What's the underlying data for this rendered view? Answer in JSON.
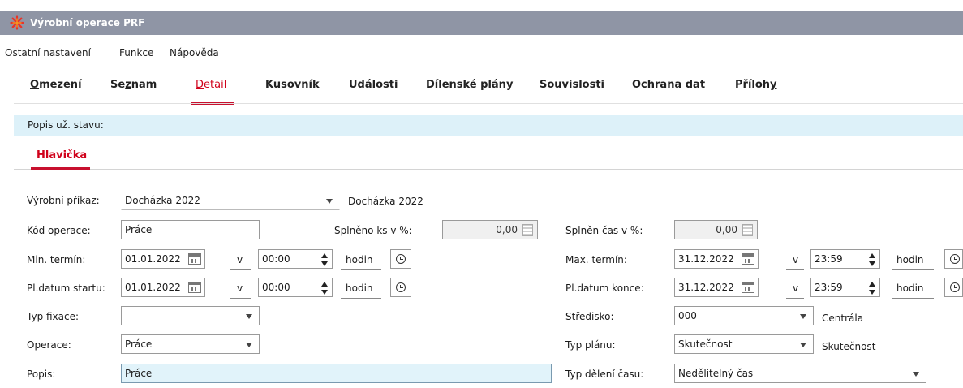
{
  "window": {
    "title": "Výrobní operace PRF",
    "logo_icon": "asterisk-logo-icon"
  },
  "menubar": [
    "Ostatní nastavení",
    "Funkce",
    "Nápověda"
  ],
  "tabs": [
    {
      "pre": "",
      "key": "O",
      "post": "mezení"
    },
    {
      "pre": "Se",
      "key": "z",
      "post": "nam"
    },
    {
      "pre": "",
      "key": "D",
      "post": "etail"
    },
    {
      "pre": "",
      "key": "",
      "post": "Kusovník"
    },
    {
      "pre": "",
      "key": "",
      "post": "Události"
    },
    {
      "pre": "",
      "key": "",
      "post": "Dílenské plány"
    },
    {
      "pre": "",
      "key": "",
      "post": "Souvislosti"
    },
    {
      "pre": "",
      "key": "",
      "post": "Ochrana dat"
    },
    {
      "pre": "Příloh",
      "key": "y",
      "post": ""
    }
  ],
  "active_tab_index": 2,
  "status": {
    "label": "Popis už. stavu:"
  },
  "subtab": "Hlavička",
  "form": {
    "vyrobni_prikaz": {
      "label": "Výrobní příkaz:",
      "value": "Docházka 2022",
      "desc": "Docházka 2022"
    },
    "kod_operace": {
      "label": "Kód operace:",
      "value": "Práce"
    },
    "splneno_ks": {
      "label": "Splněno ks v %:",
      "value": "0,00"
    },
    "splnen_cas": {
      "label": "Splněn čas v %:",
      "value": "0,00"
    },
    "min_termin": {
      "label": "Min. termín:",
      "date": "01.01.2022",
      "v": "v",
      "time": "00:00",
      "unit": "hodin"
    },
    "max_termin": {
      "label": "Max. termín:",
      "date": "31.12.2022",
      "v": "v",
      "time": "23:59",
      "unit": "hodin"
    },
    "pl_datum_startu": {
      "label": "Pl.datum startu:",
      "date": "01.01.2022",
      "v": "v",
      "time": "00:00",
      "unit": "hodin"
    },
    "pl_datum_konce": {
      "label": "Pl.datum konce:",
      "date": "31.12.2022",
      "v": "v",
      "time": "23:59",
      "unit": "hodin"
    },
    "typ_fixace": {
      "label": "Typ fixace:",
      "value": ""
    },
    "stredisko": {
      "label": "Středisko:",
      "value": "000",
      "desc": "Centrála"
    },
    "operace": {
      "label": "Operace:",
      "value": "Práce"
    },
    "typ_planu": {
      "label": "Typ plánu:",
      "value": "Skutečnost",
      "desc": "Skutečnost"
    },
    "popis": {
      "label": "Popis:",
      "value": "Práce"
    },
    "typ_deleni_casu": {
      "label": "Typ dělení času:",
      "value": "Nedělitelný čas"
    }
  },
  "colors": {
    "titlebar": "#8f95a5",
    "accent": "#c8102e",
    "status_bg": "#ddf1f9",
    "active_field": "#e1f3fa"
  }
}
